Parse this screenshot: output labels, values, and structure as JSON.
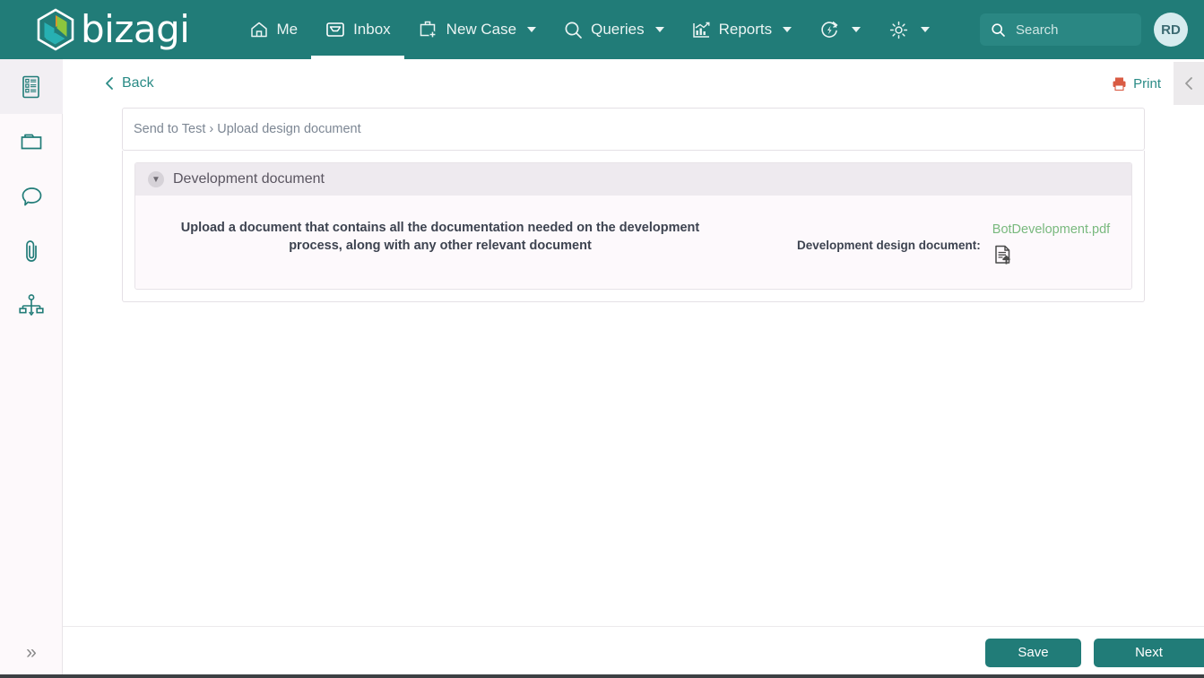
{
  "brand": {
    "name": "bizagi",
    "logo_icon": "bizagi-hexagon-logo"
  },
  "topnav": {
    "items": [
      {
        "label": "Me",
        "icon": "home-icon",
        "has_caret": false,
        "active": false
      },
      {
        "label": "Inbox",
        "icon": "inbox-icon",
        "has_caret": false,
        "active": true
      },
      {
        "label": "New Case",
        "icon": "briefcase-plus-icon",
        "has_caret": true,
        "active": false
      },
      {
        "label": "Queries",
        "icon": "search-icon",
        "has_caret": true,
        "active": false
      },
      {
        "label": "Reports",
        "icon": "chart-icon",
        "has_caret": true,
        "active": false
      }
    ],
    "icon_only": [
      {
        "icon": "refresh-bolt-icon",
        "has_caret": true
      },
      {
        "icon": "gear-icon",
        "has_caret": true
      }
    ],
    "search": {
      "placeholder": "Search",
      "value": "",
      "icon": "search-icon"
    },
    "avatar": {
      "initials": "RD"
    }
  },
  "sidebar": {
    "items": [
      {
        "icon": "form-document-icon",
        "name": "form",
        "active": true
      },
      {
        "icon": "folder-icon",
        "name": "documents",
        "active": false
      },
      {
        "icon": "comment-bubble-icon",
        "name": "comments",
        "active": false
      },
      {
        "icon": "paperclip-icon",
        "name": "attachments",
        "active": false
      },
      {
        "icon": "process-diagram-icon",
        "name": "process",
        "active": false
      }
    ],
    "expand_label": "»"
  },
  "toolbar": {
    "back_label": "Back",
    "back_icon": "chevron-left-icon",
    "print_label": "Print",
    "print_icon": "printer-icon",
    "collapse_icon": "chevron-left-icon"
  },
  "breadcrumb": {
    "text": "Send to Test › Upload design document"
  },
  "section": {
    "title": "Development document",
    "toggle_icon": "chevron-down-icon",
    "description": "Upload a document that contains all the documentation needed on the development process, along with any other relevant document",
    "field": {
      "label": "Development design document:",
      "file_name": "BotDevelopment.pdf",
      "upload_icon": "upload-document-icon"
    }
  },
  "footer": {
    "save_label": "Save",
    "next_label": "Next"
  },
  "colors": {
    "brand_teal": "#217C78",
    "accent_green": "#79b97e",
    "link_teal": "#2a8b86",
    "print_red": "#d95b43",
    "panel_bg": "#fdf9fc",
    "section_head": "#eeeaef"
  }
}
